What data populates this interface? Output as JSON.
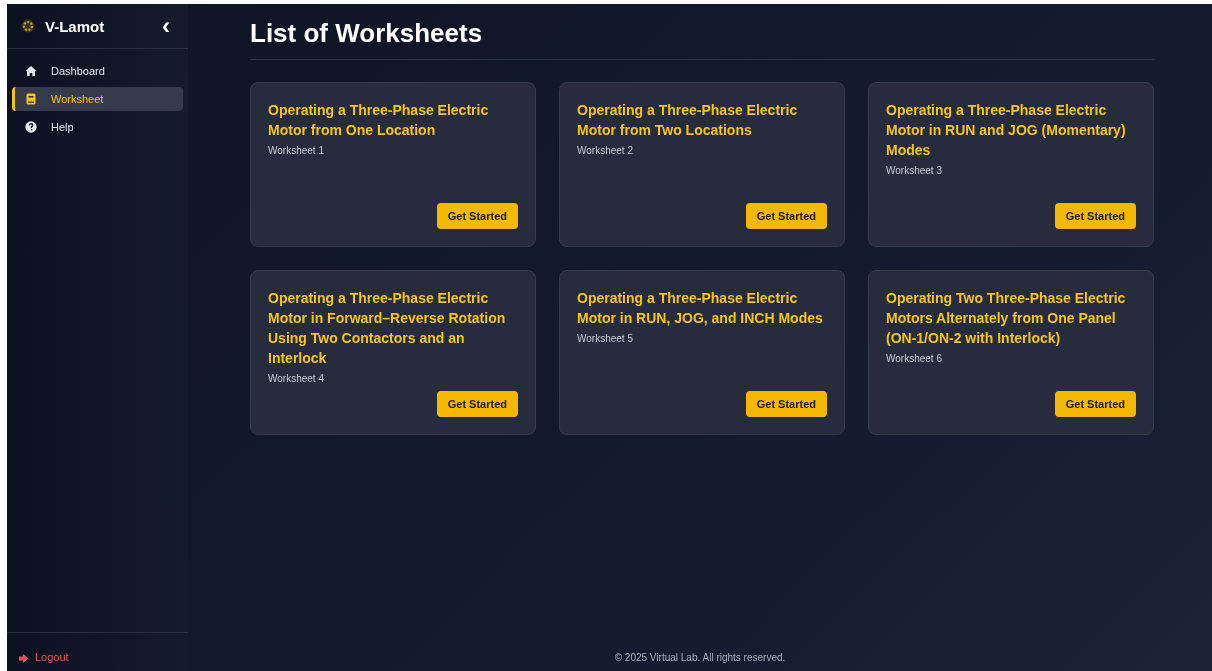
{
  "sidebar": {
    "brand": "V-Lamot",
    "collapse": "‹",
    "items": [
      {
        "label": "Dashboard",
        "kind": "home",
        "selected": false
      },
      {
        "label": "Worksheet",
        "kind": "book",
        "selected": true
      },
      {
        "label": "Help",
        "kind": "help",
        "selected": false
      }
    ],
    "logout": "Logout"
  },
  "page": {
    "title": "List of Worksheets",
    "worksheets": [
      {
        "title": "Operating a Three-Phase Electric Motor from One Location",
        "subtitle": "Worksheet 1",
        "button": "Get Started"
      },
      {
        "title": "Operating a Three-Phase Electric Motor from Two Locations",
        "subtitle": "Worksheet 2",
        "button": "Get Started"
      },
      {
        "title": "Operating a Three-Phase Electric Motor in RUN and JOG (Momentary) Modes",
        "subtitle": "Worksheet 3",
        "button": "Get Started"
      },
      {
        "title": "Operating a Three-Phase Electric Motor in Forward–Reverse Rotation Using Two Contactors and an Interlock",
        "subtitle": "Worksheet 4",
        "button": "Get Started"
      },
      {
        "title": "Operating a Three-Phase Electric Motor in RUN, JOG, and INCH Modes",
        "subtitle": "Worksheet 5",
        "button": "Get Started"
      },
      {
        "title": "Operating Two Three-Phase Electric Motors Alternately from One Panel (ON-1/ON-2 with Interlock)",
        "subtitle": "Worksheet 6",
        "button": "Get Started"
      }
    ]
  },
  "footer": "© 2025 Virtual Lab. All rights reserved."
}
